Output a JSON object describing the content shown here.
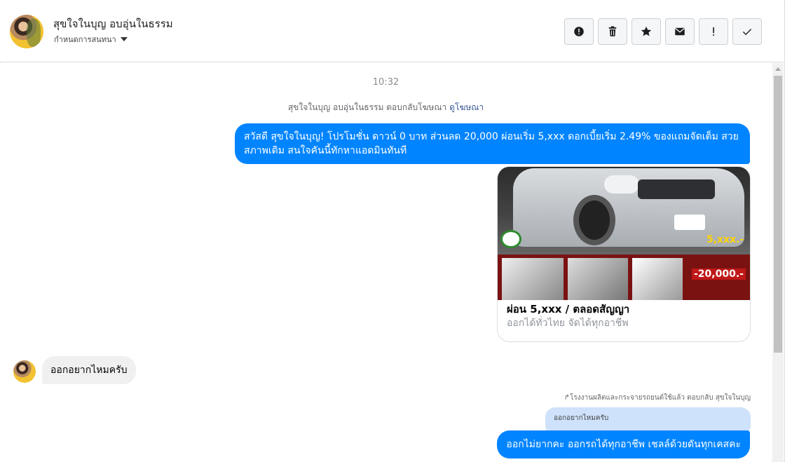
{
  "header": {
    "contact_name": "สุขใจในบุญ อบอุ่นในธรรม",
    "assign_label": "กำหนดการสนทนา",
    "actions": [
      {
        "icon": "alert-circle-icon",
        "label": "Spam"
      },
      {
        "icon": "trash-icon",
        "label": "Delete"
      },
      {
        "icon": "star-icon",
        "label": "Follow up"
      },
      {
        "icon": "envelope-icon",
        "label": "Mark as unread"
      },
      {
        "icon": "exclamation-icon",
        "label": "Priority"
      },
      {
        "icon": "check-icon",
        "label": "Done"
      }
    ]
  },
  "thread": {
    "timestamp": "10:32",
    "ad_reply_note": "สุขใจในบุญ อบอุ่นในธรรม ตอบกลับโฆษณา",
    "view_ad_link": "ดูโฆษณา",
    "outgoing_message_1": "สวัสดี สุขใจในบุญ! โปรโมชั่น ดาวน์ 0 บาท ส่วนลด 20,000 ผ่อนเริ่ม 5,xxx ดอกเบี้ยเริ่ม 2.49% ของแถมจัดเต็ม สวยสภาพเดิม สนใจคันนี้ทักหาแอดมินทันที",
    "ad_card": {
      "title": "ผ่อน 5,xxx / ตลอดสัญญา",
      "subtitle": "ออกได้ทั่วไทย จัดได้ทุกอาชีพ",
      "image_price_text": "5,xxx.-",
      "image_discount_text": "-20,000.-"
    },
    "incoming_message_1": "ออกอยากไหมครับ",
    "reply_meta": "↱โรงงานผลิตและกระจายรถยนต์ใช้แล้ว ตอบกลับ สุขใจในบุญ",
    "quoted_text": "ออกอยากไหมครับ",
    "outgoing_message_2": "ออกไม่ยากคะ ออกรถได้ทุกอาชีพ เชลล์ด้วยดันทุกเคสคะ"
  },
  "colors": {
    "outgoing_bubble": "#0084ff",
    "incoming_bubble": "#f1f0f0",
    "quote_bubble": "#cfe2fb",
    "link": "#385898"
  }
}
